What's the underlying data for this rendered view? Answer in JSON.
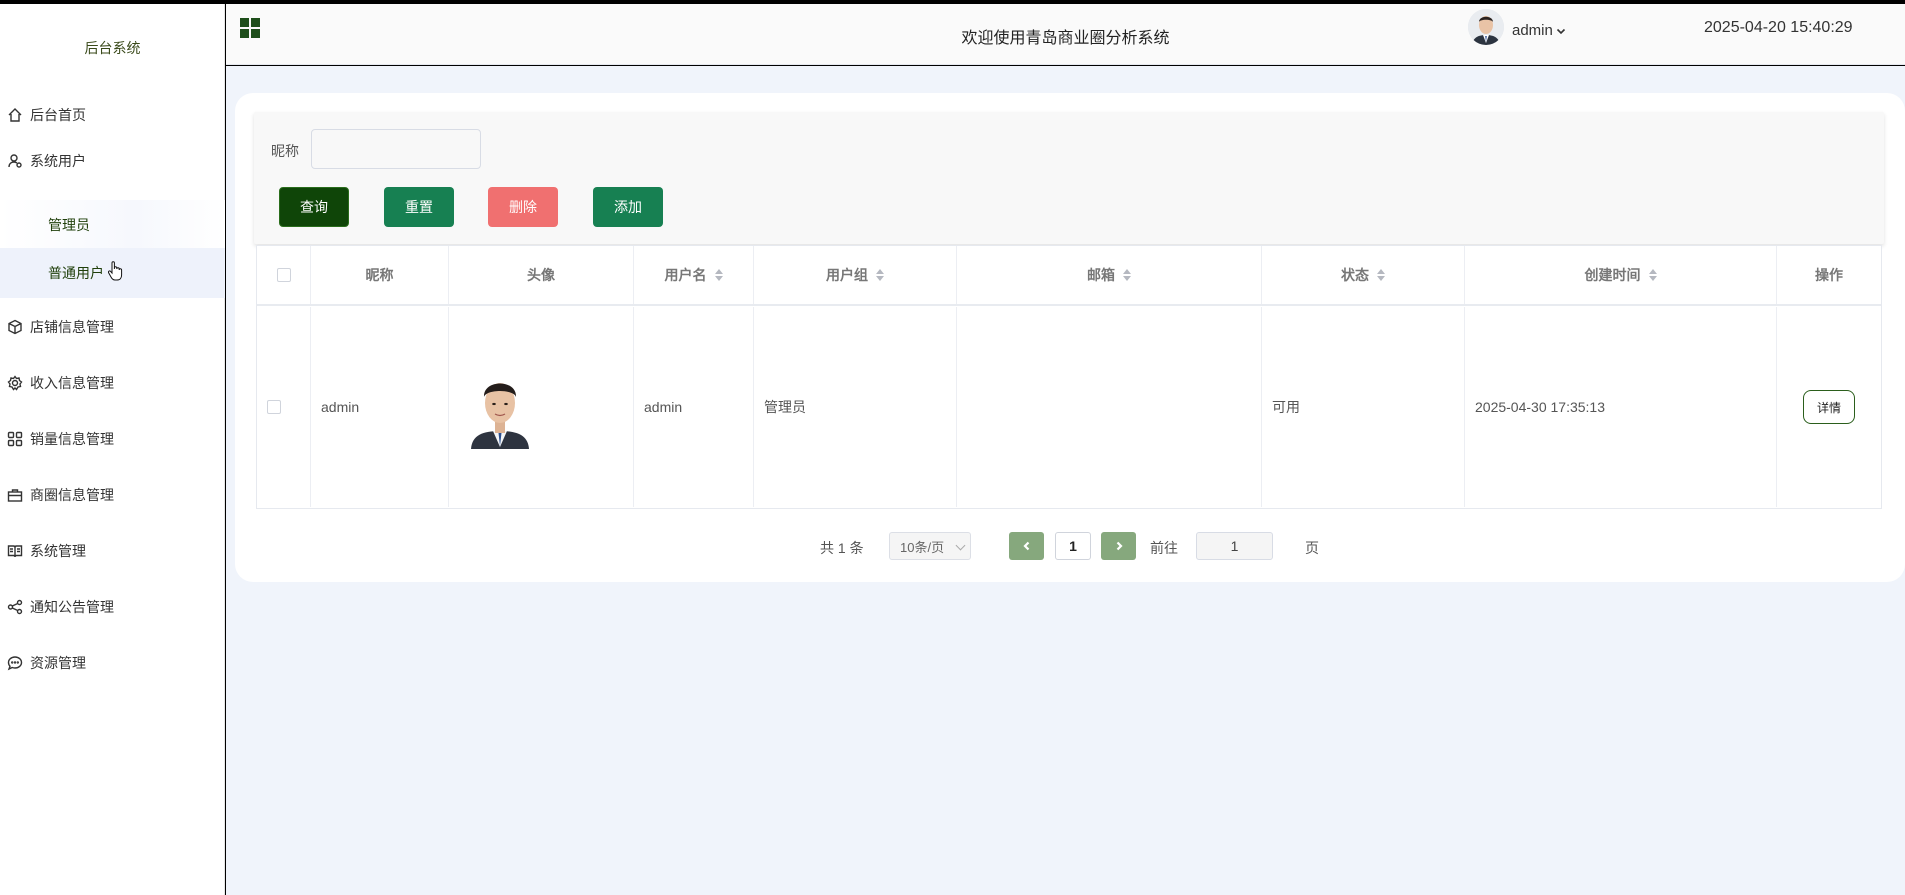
{
  "app": {
    "brand": "后台系统",
    "welcome": "欢迎使用青岛商业圈分析系统",
    "user": "admin",
    "clock": "2025-04-20 15:40:29"
  },
  "sidebar": {
    "items": [
      {
        "label": "后台首页",
        "icon": "home-icon"
      },
      {
        "label": "系统用户",
        "icon": "user-gear-icon"
      },
      {
        "label": "店铺信息管理",
        "icon": "cube-icon"
      },
      {
        "label": "收入信息管理",
        "icon": "settings-icon"
      },
      {
        "label": "销量信息管理",
        "icon": "grid-icon"
      },
      {
        "label": "商圈信息管理",
        "icon": "briefcase-icon"
      },
      {
        "label": "系统管理",
        "icon": "book-icon"
      },
      {
        "label": "通知公告管理",
        "icon": "share-icon"
      },
      {
        "label": "资源管理",
        "icon": "chat-icon"
      }
    ],
    "subitems": [
      "管理员",
      "普通用户"
    ]
  },
  "search": {
    "label": "昵称",
    "value": "",
    "buttons": {
      "query": "查询",
      "reset": "重置",
      "delete": "删除",
      "add": "添加"
    }
  },
  "table": {
    "headers": [
      "昵称",
      "头像",
      "用户名",
      "用户组",
      "邮箱",
      "状态",
      "创建时间",
      "操作"
    ],
    "rows": [
      {
        "nickname": "admin",
        "username": "admin",
        "group": "管理员",
        "email": "",
        "status": "可用",
        "created": "2025-04-30 17:35:13",
        "action": "详情"
      }
    ]
  },
  "pagination": {
    "total": "共 1 条",
    "size": "10条/页",
    "current": "1",
    "goto": "前往",
    "goto_value": "1",
    "page": "页"
  },
  "colors": {
    "accent": "#178052",
    "query": "#0f4508",
    "danger": "#f07070"
  }
}
